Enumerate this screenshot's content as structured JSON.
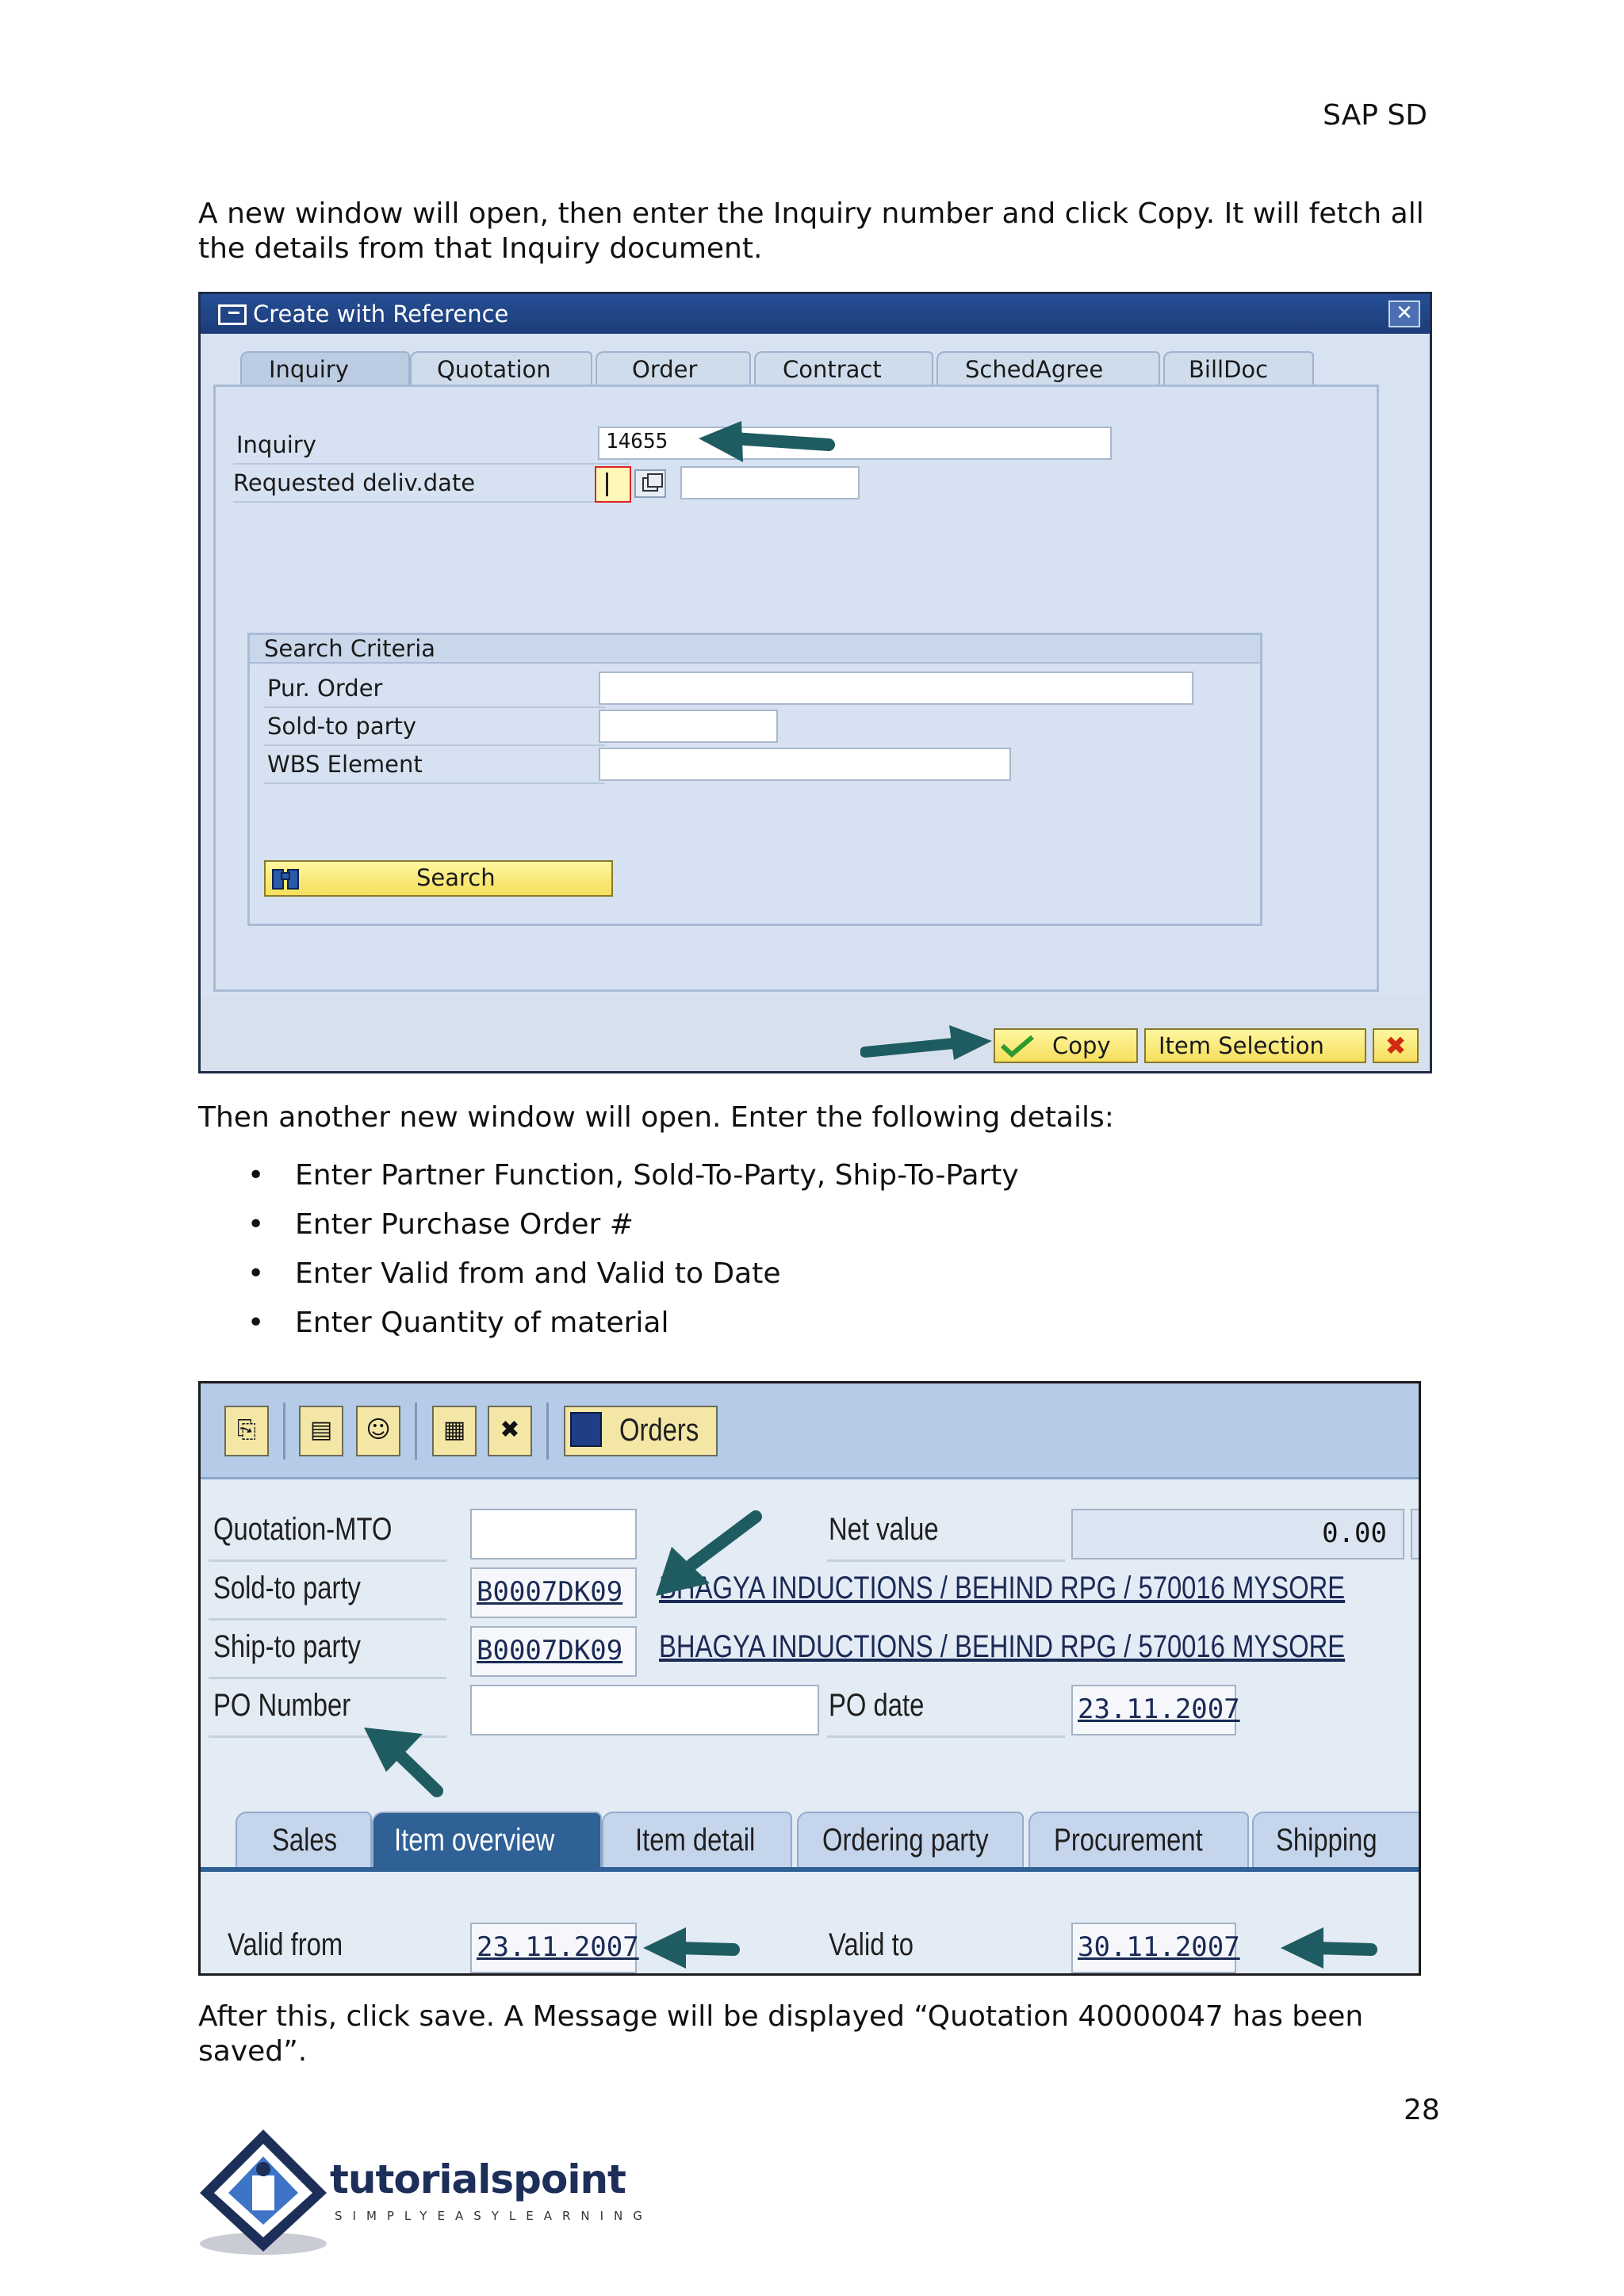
{
  "header": {
    "title": "SAP SD"
  },
  "intro": "A new window will open, then enter the Inquiry number and click Copy. It will fetch all the details from that Inquiry document.",
  "dialog1": {
    "title": "Create with Reference",
    "tabs": [
      "Inquiry",
      "Quotation",
      "Order",
      "Contract",
      "SchedAgree",
      "BillDoc"
    ],
    "inquiry_label": "Inquiry",
    "inquiry_value": "14655",
    "req_date_label": "Requested deliv.date",
    "search_title": "Search Criteria",
    "pur_order_label": "Pur. Order",
    "sold_to_label": "Sold-to party",
    "wbs_label": "WBS Element",
    "search_button": "Search",
    "copy_button": "Copy",
    "item_selection_button": "Item Selection"
  },
  "then_text": "Then another new window will open. Enter the following details:",
  "bullets": [
    "Enter Partner Function, Sold-To-Party, Ship-To-Party",
    "Enter Purchase Order #",
    "Enter Valid from and Valid to Date",
    "Enter Quantity of material"
  ],
  "screen2": {
    "orders_button": "Orders",
    "quotation_label": "Quotation-MTO",
    "net_value_label": "Net value",
    "net_value": "0.00",
    "net_value_cutoff": "I",
    "sold_to_label": "Sold-to party",
    "sold_to_value": "B0007DK09",
    "sold_to_text": "BHAGYA INDUCTIONS / BEHIND RPG / 570016 MYSORE",
    "ship_to_label": "Ship-to party",
    "ship_to_value": "B0007DK09",
    "ship_to_text": "BHAGYA INDUCTIONS / BEHIND RPG / 570016 MYSORE",
    "po_number_label": "PO Number",
    "po_date_label": "PO date",
    "po_date_value": "23.11.2007",
    "tabs": [
      "Sales",
      "Item overview",
      "Item detail",
      "Ordering party",
      "Procurement",
      "Shipping"
    ],
    "valid_from_label": "Valid from",
    "valid_from_value": "23.11.2007",
    "valid_to_label": "Valid to",
    "valid_to_value": "30.11.2007"
  },
  "after_text": "After this, click save. A Message will be displayed “Quotation 40000047 has been saved”.",
  "page_number": "28",
  "logo": {
    "name": "tutorialspoint",
    "tagline": "SIMPLYEASYLEARNING"
  },
  "colors": {
    "sap_title": "#264f96",
    "arrow": "#1f5c61",
    "yellow_button": "#f5df5c",
    "active_tab": "#2f6096"
  }
}
